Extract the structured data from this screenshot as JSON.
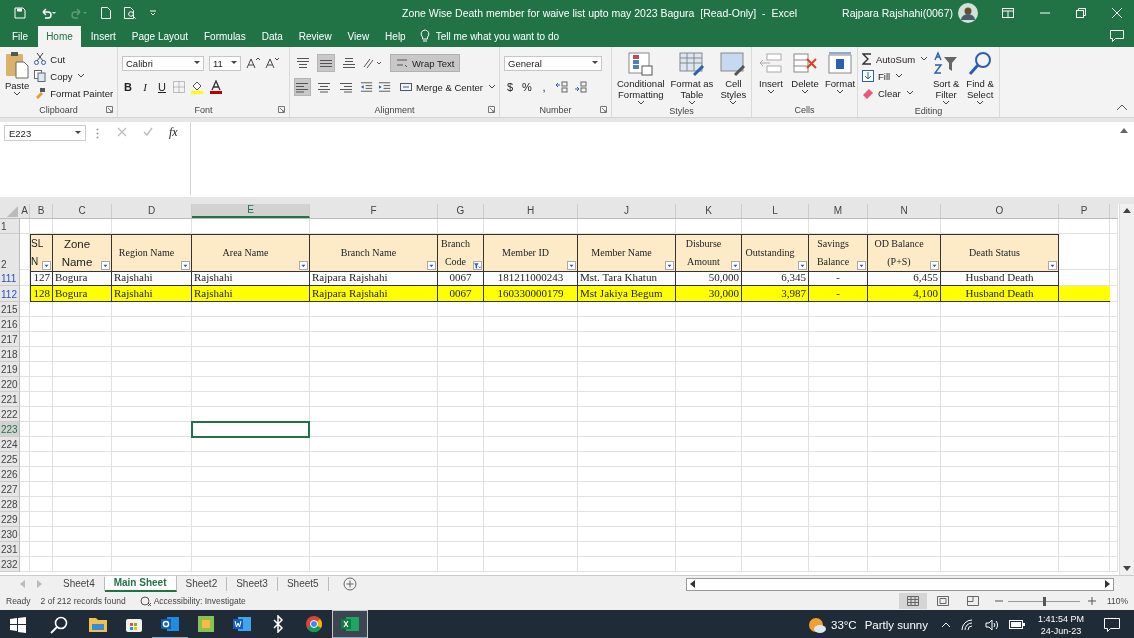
{
  "title_bar": {
    "quick_access": [
      {
        "kind": "save",
        "disabled": false
      },
      {
        "kind": "undo",
        "disabled": false
      },
      {
        "kind": "redo",
        "disabled": true
      },
      {
        "kind": "new",
        "disabled": false
      },
      {
        "kind": "preview",
        "disabled": false
      },
      {
        "kind": "customize",
        "disabled": false
      }
    ],
    "title": "Zone Wise Death member for waive list upto may 2023 Bagura  [Read-Only]  -  Excel",
    "user": "Rajpara Rajshahi(0067)"
  },
  "menu_tabs": [
    {
      "label": "File",
      "selected": false
    },
    {
      "label": "Home",
      "selected": true
    },
    {
      "label": "Insert",
      "selected": false
    },
    {
      "label": "Page Layout",
      "selected": false
    },
    {
      "label": "Formulas",
      "selected": false
    },
    {
      "label": "Data",
      "selected": false
    },
    {
      "label": "Review",
      "selected": false
    },
    {
      "label": "View",
      "selected": false
    },
    {
      "label": "Help",
      "selected": false
    }
  ],
  "tell_me": "Tell me what you want to do",
  "ribbon": {
    "clipboard": {
      "label": "Clipboard",
      "paste": "Paste",
      "cut": "Cut",
      "copy": "Copy",
      "format_painter": "Format Painter"
    },
    "font": {
      "label": "Font",
      "font_name": "Calibri",
      "size": "11",
      "bold": "B",
      "italic": "I",
      "underline": "U"
    },
    "alignment": {
      "label": "Alignment",
      "buttons": [
        {
          "kind": "top",
          "on": false
        },
        {
          "kind": "middle",
          "on": true
        },
        {
          "kind": "bottom",
          "on": false
        },
        {
          "kind": "left",
          "on": true
        },
        {
          "kind": "center",
          "on": false
        },
        {
          "kind": "right",
          "on": false
        }
      ],
      "wrap_text": {
        "label": "Wrap Text",
        "on": true
      },
      "merge": "Merge & Center"
    },
    "number": {
      "label": "Number",
      "format": "General",
      "currency": "$",
      "percent": "%",
      "comma": ","
    },
    "styles": {
      "label": "Styles",
      "buttons": [
        {
          "kind": "conditional",
          "label": "Conditional\nFormatting"
        },
        {
          "kind": "table",
          "label": "Format as\nTable"
        },
        {
          "kind": "cellstyles",
          "label": "Cell\nStyles"
        }
      ]
    },
    "cells": {
      "label": "Cells",
      "buttons": [
        {
          "kind": "insert",
          "label": "Insert"
        },
        {
          "kind": "delete",
          "label": "Delete"
        },
        {
          "kind": "format",
          "label": "Format"
        }
      ]
    },
    "editing": {
      "label": "Editing",
      "autosum": "AutoSum",
      "fill": "Fill",
      "clear": "Clear",
      "buttons": [
        {
          "kind": "sort",
          "label": "Sort &\nFilter"
        },
        {
          "kind": "find",
          "label": "Find &\nSelect"
        }
      ]
    }
  },
  "formula_bar": {
    "name_box": "E223",
    "fx": "fx"
  },
  "sheet": {
    "columns": [
      {
        "letter": "A",
        "selected": false
      },
      {
        "letter": "B",
        "selected": false
      },
      {
        "letter": "C",
        "selected": false
      },
      {
        "letter": "D",
        "selected": false
      },
      {
        "letter": "E",
        "selected": true
      },
      {
        "letter": "F",
        "selected": false
      },
      {
        "letter": "G",
        "selected": false
      },
      {
        "letter": "H",
        "selected": false
      },
      {
        "letter": "J",
        "selected": false
      },
      {
        "letter": "K",
        "selected": false
      },
      {
        "letter": "L",
        "selected": false
      },
      {
        "letter": "M",
        "selected": false
      },
      {
        "letter": "N",
        "selected": false
      },
      {
        "letter": "O",
        "selected": false
      },
      {
        "letter": "P",
        "selected": false
      }
    ],
    "top_row": "1",
    "header_row": {
      "number": "2",
      "cells": [
        {
          "label": "SL\nN",
          "filtered": false
        },
        {
          "label": "Zone\nName",
          "filtered": false
        },
        {
          "label": "Region Name",
          "filtered": false
        },
        {
          "label": "Area Name",
          "filtered": false
        },
        {
          "label": "Branch Name",
          "filtered": false
        },
        {
          "label": "Branch\nCode",
          "filtered": true
        },
        {
          "label": "Member ID",
          "filtered": false
        },
        {
          "label": "Member Name",
          "filtered": false
        },
        {
          "label": "Disburse\nAmount",
          "filtered": false
        },
        {
          "label": "Outstanding",
          "filtered": false
        },
        {
          "label": "Savings\nBalance",
          "filtered": false
        },
        {
          "label": "OD Balance\n(P+S)",
          "filtered": false
        },
        {
          "label": "Death Status",
          "filtered": false
        }
      ]
    },
    "data_rows": [
      {
        "number": "111",
        "highlighted": false,
        "cells": [
          "127",
          "Bogura",
          "Rajshahi",
          "Rajshahi",
          "Rajpara Rajshahi",
          "0067",
          "181211000243",
          "Mst. Tara Khatun",
          "50,000",
          "6,345",
          "-",
          "6,455",
          "Husband Death"
        ]
      },
      {
        "number": "112",
        "highlighted": true,
        "cells": [
          "128",
          "Bogura",
          "Rajshahi",
          "Rajshahi",
          "Rajpara Rajshahi",
          "0067",
          "160330000179",
          "Mst Jakiya Begum",
          "30,000",
          "3,987",
          "-",
          "4,100",
          "Husband Death"
        ]
      }
    ],
    "empty_rows": [
      {
        "number": "215",
        "selected": false
      },
      {
        "number": "216",
        "selected": false
      },
      {
        "number": "217",
        "selected": false
      },
      {
        "number": "218",
        "selected": false
      },
      {
        "number": "219",
        "selected": false
      },
      {
        "number": "220",
        "selected": false
      },
      {
        "number": "221",
        "selected": false
      },
      {
        "number": "222",
        "selected": false
      },
      {
        "number": "223",
        "selected": true
      },
      {
        "number": "224",
        "selected": false
      },
      {
        "number": "225",
        "selected": false
      },
      {
        "number": "226",
        "selected": false
      },
      {
        "number": "227",
        "selected": false
      },
      {
        "number": "228",
        "selected": false
      },
      {
        "number": "229",
        "selected": false
      },
      {
        "number": "230",
        "selected": false
      },
      {
        "number": "231",
        "selected": false
      },
      {
        "number": "232",
        "selected": false
      }
    ]
  },
  "sheet_tabs": [
    {
      "label": "Sheet4",
      "selected": false
    },
    {
      "label": "Main Sheet",
      "selected": true
    },
    {
      "label": "Sheet2",
      "selected": false
    },
    {
      "label": "Sheet3",
      "selected": false
    },
    {
      "label": "Sheet5",
      "selected": false
    }
  ],
  "status_bar": {
    "ready": "Ready",
    "records": "2 of 212 records found",
    "accessibility": "Accessibility: Investigate",
    "views": [
      {
        "kind": "normal",
        "selected": true
      },
      {
        "kind": "page_layout",
        "selected": false
      },
      {
        "kind": "page_break",
        "selected": false
      }
    ],
    "zoom": {
      "level": 0.5,
      "label": "110%"
    }
  },
  "taskbar": {
    "apps": [
      {
        "kind": "explorer",
        "running": false,
        "selected": false
      },
      {
        "kind": "store",
        "running": false,
        "selected": false
      },
      {
        "kind": "outlook",
        "running": true,
        "selected": false
      },
      {
        "kind": "photos",
        "running": false,
        "selected": false
      },
      {
        "kind": "word",
        "running": false,
        "selected": false
      },
      {
        "kind": "bluetooth",
        "running": false,
        "selected": false
      },
      {
        "kind": "chrome",
        "running": false,
        "selected": false
      },
      {
        "kind": "excel",
        "running": true,
        "selected": true
      }
    ],
    "temperature": "33°C",
    "weather": "Partly sunny",
    "time": "1:41:54 PM",
    "date": "24-Jun-23"
  }
}
